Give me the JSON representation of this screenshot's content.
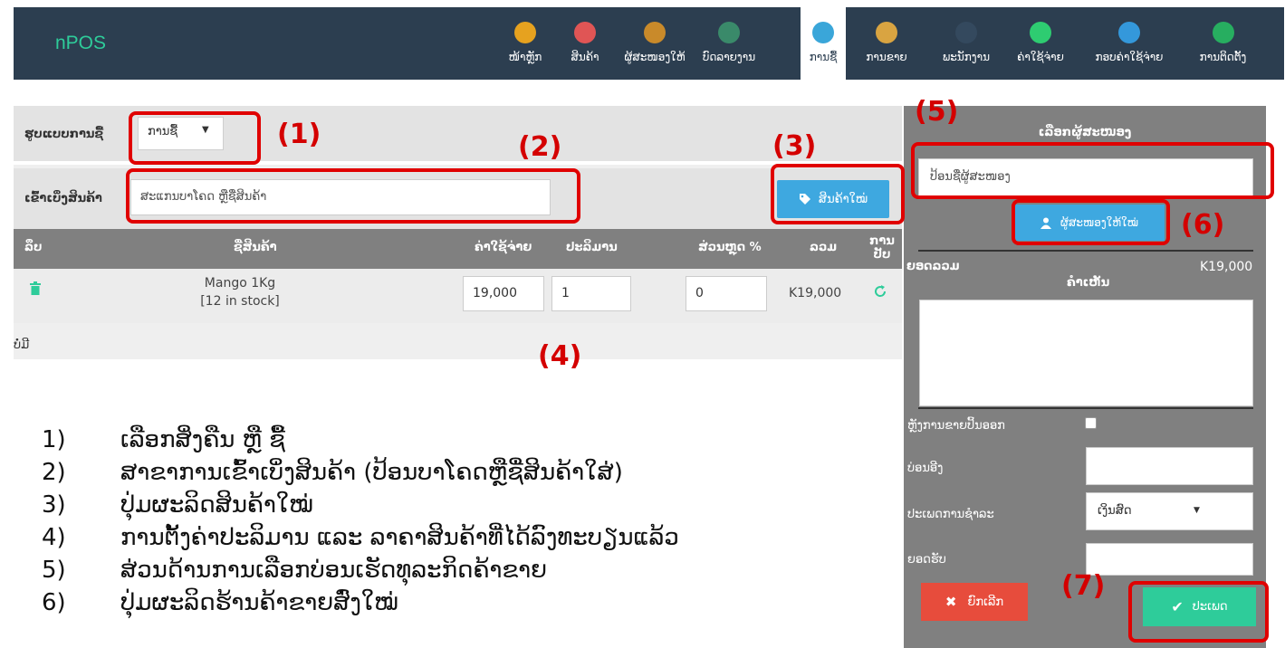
{
  "app": {
    "brand": "nPOS"
  },
  "nav": [
    {
      "label": "ໜ້າຫຼັກ",
      "icon": "battery-icon",
      "color": "#e6a21f"
    },
    {
      "label": "ສິນຄ້າ",
      "icon": "tag-icon",
      "color": "#e05555"
    },
    {
      "label": "ຜູ້ສະໜອງໃຫ້",
      "icon": "briefcase-icon",
      "color": "#c98a2a"
    },
    {
      "label": "ບົດລາຍງານ",
      "icon": "chart-icon",
      "color": "#3a8a6a"
    },
    {
      "label": "ການຊື້",
      "icon": "pencil-icon",
      "color": "#3aa6d9",
      "active": true
    },
    {
      "label": "ການຂາຍ",
      "icon": "basket-icon",
      "color": "#d9a441"
    },
    {
      "label": "ພະນັກງານ",
      "icon": "user-icon",
      "color": "#34495e"
    },
    {
      "label": "ຄ່າໃຊ້ຈ່າຍ",
      "icon": "edit-icon",
      "color": "#2ecc71"
    },
    {
      "label": "ກອບຄ່າໃຊ້ຈ່າຍ",
      "icon": "clipboard-icon",
      "color": "#3498db"
    },
    {
      "label": "ການຕິດຕັ້ງ",
      "icon": "gear-icon",
      "color": "#27ae60"
    }
  ],
  "purchase": {
    "mode_label": "ຮູບແບບການຊື້",
    "mode_value": "ການຊື້",
    "search_label": "ເຂົ້າເບິ່ງສິນຄ້າ",
    "search_placeholder": "ສະແກນບາໂຄດ ຫຼືຊື່ສິນຄ້າ",
    "new_product_label": "ສິນຄ້າໃໝ່"
  },
  "table": {
    "headers": {
      "delete": "ລຶບ",
      "name": "ຊື່ສິນຄ້າ",
      "cost": "ຄ່າໃຊ້ຈ່າຍ",
      "qty": "ປະລິມານ",
      "discount": "ສ່ວນຫຼຸດ %",
      "total": "ລວມ",
      "update": "ການ ປັບ"
    },
    "rows": [
      {
        "name": "Mango 1Kg",
        "stock": "[12 in stock]",
        "cost": "19,000",
        "qty": "1",
        "discount": "0",
        "total": "K19,000"
      }
    ],
    "none_label": "ບໍ່ມີ"
  },
  "supplier": {
    "title": "ເລືອກຜູ້ສະໜອງ",
    "input_placeholder": "ປ້ອນຊື່ຜູ້ສະໜອງ",
    "new_supplier_label": "ຜູ້ສະໜອງໃຫ້ໃໝ່",
    "total_label": "ຍອດລວມ",
    "total_value": "K19,000",
    "comment_label": "ຄໍາເຫັນ",
    "print_label": "ຫຼັງການຂາຍປິ້ນອອກ",
    "ref_label": "ບ່ອນອີງ",
    "payment_type_label": "ປະເພດການຊໍາລະ",
    "payment_type_value": "ເງິນສົດ",
    "received_label": "ຍອດຮັບ",
    "cancel_label": "ຍົກເລີກ",
    "save_label": "ປະເພດ"
  },
  "callouts": [
    "(1)",
    "(2)",
    "(3)",
    "(4)",
    "(5)",
    "(6)",
    "(7)"
  ],
  "legend": [
    {
      "num": "1)",
      "text": "ເລືອກສິ່ງຄືນ ຫຼື ຊື້"
    },
    {
      "num": "2)",
      "text": "ສາຂາການເຂົ້າເບິ່ງສິນຄ້າ (ປ້ອນບາໂຄດຫຼືຊື່ສິນຄ້າໃສ່)"
    },
    {
      "num": "3)",
      "text": "ປຸ່ມຜະລິດສິນຄ້າໃໝ່"
    },
    {
      "num": "4)",
      "text": "ການຕັ້ງຄ່າປະລິມານ ແລະ ລາຄາສິນຄ້າທີ່ໄດ້ລົງທະບຽນແລ້ວ"
    },
    {
      "num": "5)",
      "text": "ສ່ວນດ້ານການເລືອກບ່ອນເຮັດທຸລະກິດຄ້າຂາຍ"
    },
    {
      "num": "6)",
      "text": "ປຸ່ມຜະລິດຮ້ານຄ້າຂາຍສົ່ງໃໝ່"
    }
  ]
}
